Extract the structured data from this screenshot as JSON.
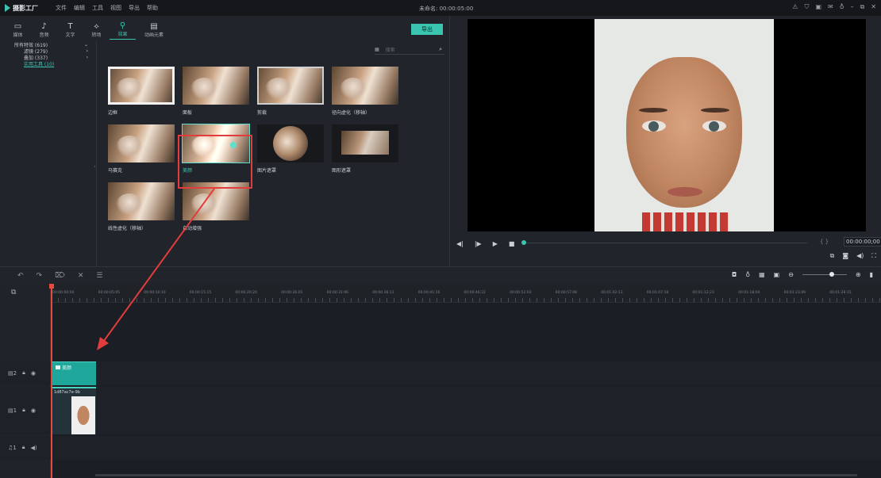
{
  "app": {
    "logo_text": "摄影工厂",
    "menu": [
      "文件",
      "编辑",
      "工具",
      "视图",
      "导出",
      "帮助"
    ],
    "doc_title": "未命名: 00:00:05:00"
  },
  "toolbar": {
    "tabs": [
      {
        "label": "媒体",
        "icon": "folder-icon"
      },
      {
        "label": "音频",
        "icon": "music-icon"
      },
      {
        "label": "文字",
        "icon": "text-icon"
      },
      {
        "label": "转场",
        "icon": "transition-icon"
      },
      {
        "label": "效果",
        "icon": "effects-icon",
        "active": true
      },
      {
        "label": "动画元素",
        "icon": "elements-icon"
      }
    ],
    "export_label": "导出"
  },
  "categories": [
    {
      "label": "所有特效 (619)",
      "arrow": "⌄"
    },
    {
      "label": "滤镜 (279)",
      "arrow": "›"
    },
    {
      "label": "叠加 (337)",
      "arrow": "›"
    },
    {
      "label": "实用工具 (10)",
      "arrow": ""
    }
  ],
  "search": {
    "placeholder": "搜索"
  },
  "effects": [
    {
      "label": "边框",
      "style": "frame"
    },
    {
      "label": "面板",
      "style": ""
    },
    {
      "label": "剪裁",
      "style": ""
    },
    {
      "label": "径向虚化（移轴）",
      "style": ""
    },
    {
      "label": "马赛克",
      "style": "mosaic"
    },
    {
      "label": "美颜",
      "style": "bright teal-dot",
      "selected": true
    },
    {
      "label": "图片遮罩",
      "style": "circle"
    },
    {
      "label": "图形遮罩",
      "style": "shape"
    },
    {
      "label": "线性虚化（移轴）",
      "style": ""
    },
    {
      "label": "自动增强",
      "style": ""
    }
  ],
  "preview": {
    "timecode": "00:00:00;00",
    "brackets": "{ }",
    "progress": 0.0
  },
  "timeline": {
    "ruler_labels": [
      "00:00:00:00",
      "00:00:05:05",
      "00:00:10:10",
      "00:00:15:15",
      "00:00:20:20",
      "00:00:26:01",
      "00:00:31:06",
      "00:00:36:11",
      "00:00:41:16",
      "00:00:46:22",
      "00:00:52:03",
      "00:00:57:08",
      "00:01:02:13",
      "00:01:07:18",
      "00:01:12:23",
      "00:01:18:04",
      "00:01:23:09",
      "00:01:28:15"
    ],
    "tracks": [
      {
        "name": "2",
        "kind": "video"
      },
      {
        "name": "1",
        "kind": "video"
      },
      {
        "name": "1",
        "kind": "audio"
      }
    ],
    "effect_clip_label": "美颜",
    "video_clip_label": "1d87ac7e-9b"
  },
  "colors": {
    "accent": "#3bc4b0",
    "highlight": "#e23c3c",
    "playhead": "#e84a3d"
  }
}
